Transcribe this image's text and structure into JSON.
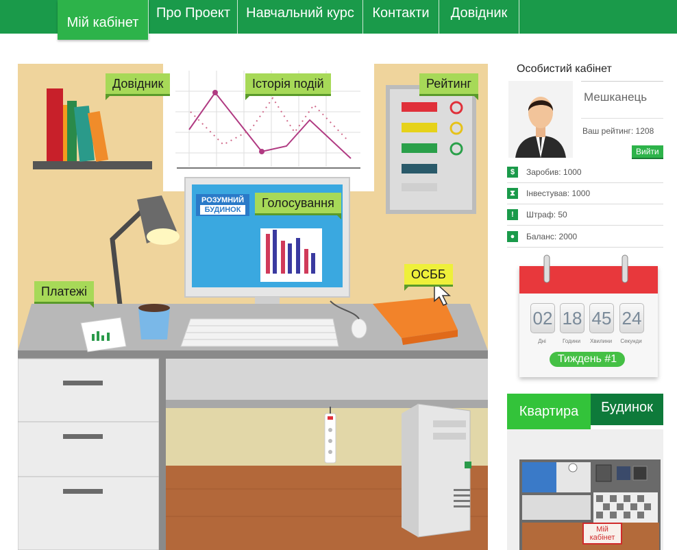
{
  "nav": {
    "items": [
      {
        "label": "Мій кабінет",
        "active": true
      },
      {
        "label": "Про Проект"
      },
      {
        "label": "Навчальний курс"
      },
      {
        "label": "Контакти"
      },
      {
        "label": "Довідник"
      }
    ]
  },
  "scene": {
    "tags": {
      "reference": "Довідник",
      "history": "Історія подій",
      "rating": "Рейтинг",
      "voting": "Голосування",
      "payments": "Платежі",
      "osbb": "ОСББ"
    },
    "monitor_logo": {
      "line1": "РОЗУМНИЙ",
      "line2": "БУДИНОК"
    }
  },
  "cabinet": {
    "title": "Особистий кабінет",
    "username": "Мешканець",
    "rating_text": "Ваш рейтинг: 1208",
    "logout_label": "Вийти",
    "stats": [
      {
        "icon": "money-bag-icon",
        "glyph": "$",
        "text": "Заробив: 1000"
      },
      {
        "icon": "hourglass-icon",
        "glyph": "⧗",
        "text": "Інвестував: 1000"
      },
      {
        "icon": "exclamation-icon",
        "glyph": "!",
        "text": "Штраф: 50"
      },
      {
        "icon": "piggy-bank-icon",
        "glyph": "●",
        "text": "Баланс: 2000"
      }
    ]
  },
  "calendar": {
    "days": "02",
    "hours": "18",
    "minutes": "45",
    "seconds": "24",
    "days_label": "Дні",
    "hours_label": "Години",
    "minutes_label": "Хвилини",
    "seconds_label": "Секунди",
    "week_label": "Тиждень #1"
  },
  "tabs": {
    "apartment": "Квартира",
    "building": "Будинок"
  },
  "floorplan": {
    "room_label_line1": "Мій",
    "room_label_line2": "кабінет"
  },
  "colors": {
    "nav": "#1a9a4a",
    "active_tab": "#2db34a",
    "accent_lime": "#a7d958",
    "red": "#e8383c"
  }
}
